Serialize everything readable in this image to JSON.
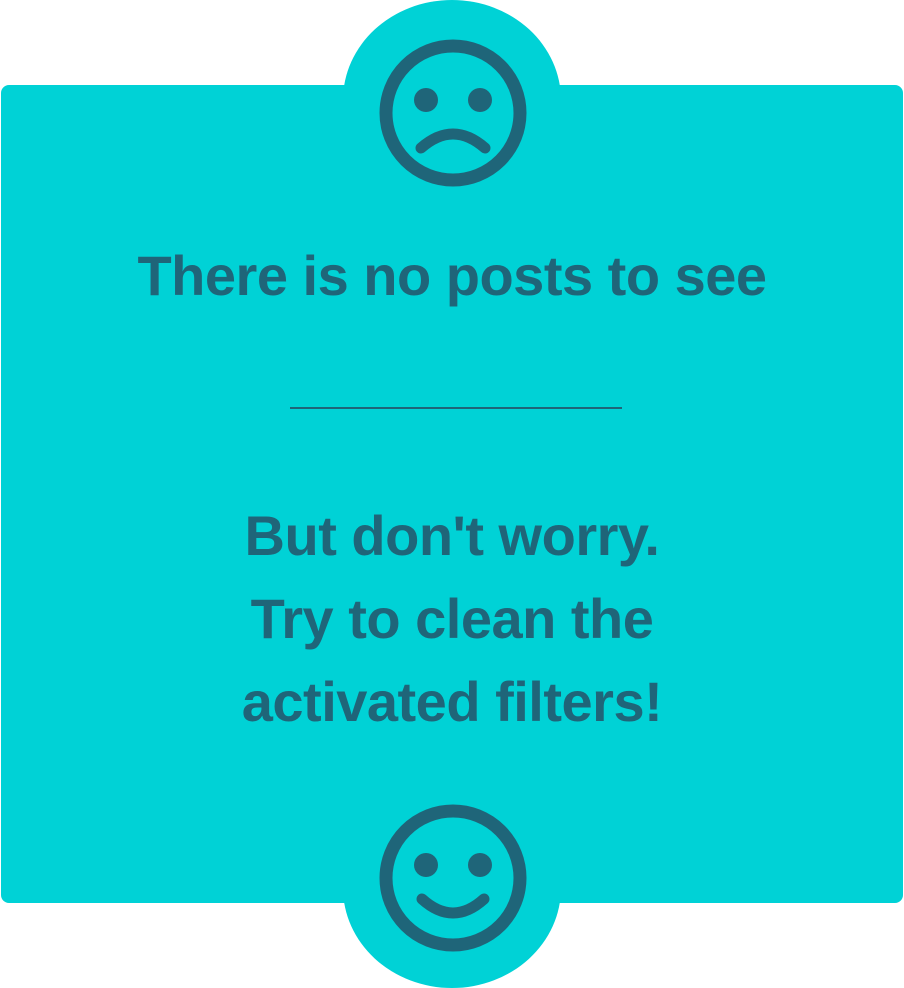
{
  "empty_state": {
    "title": "There is no posts to see",
    "message_lines": [
      "But don't worry.",
      "Try to clean the",
      "activated filters!"
    ],
    "icons": {
      "top": "sad-face-icon",
      "bottom": "happy-face-icon"
    }
  },
  "colors": {
    "background": "#00d2d6",
    "foreground": "#1f6579",
    "page": "#ffffff"
  }
}
